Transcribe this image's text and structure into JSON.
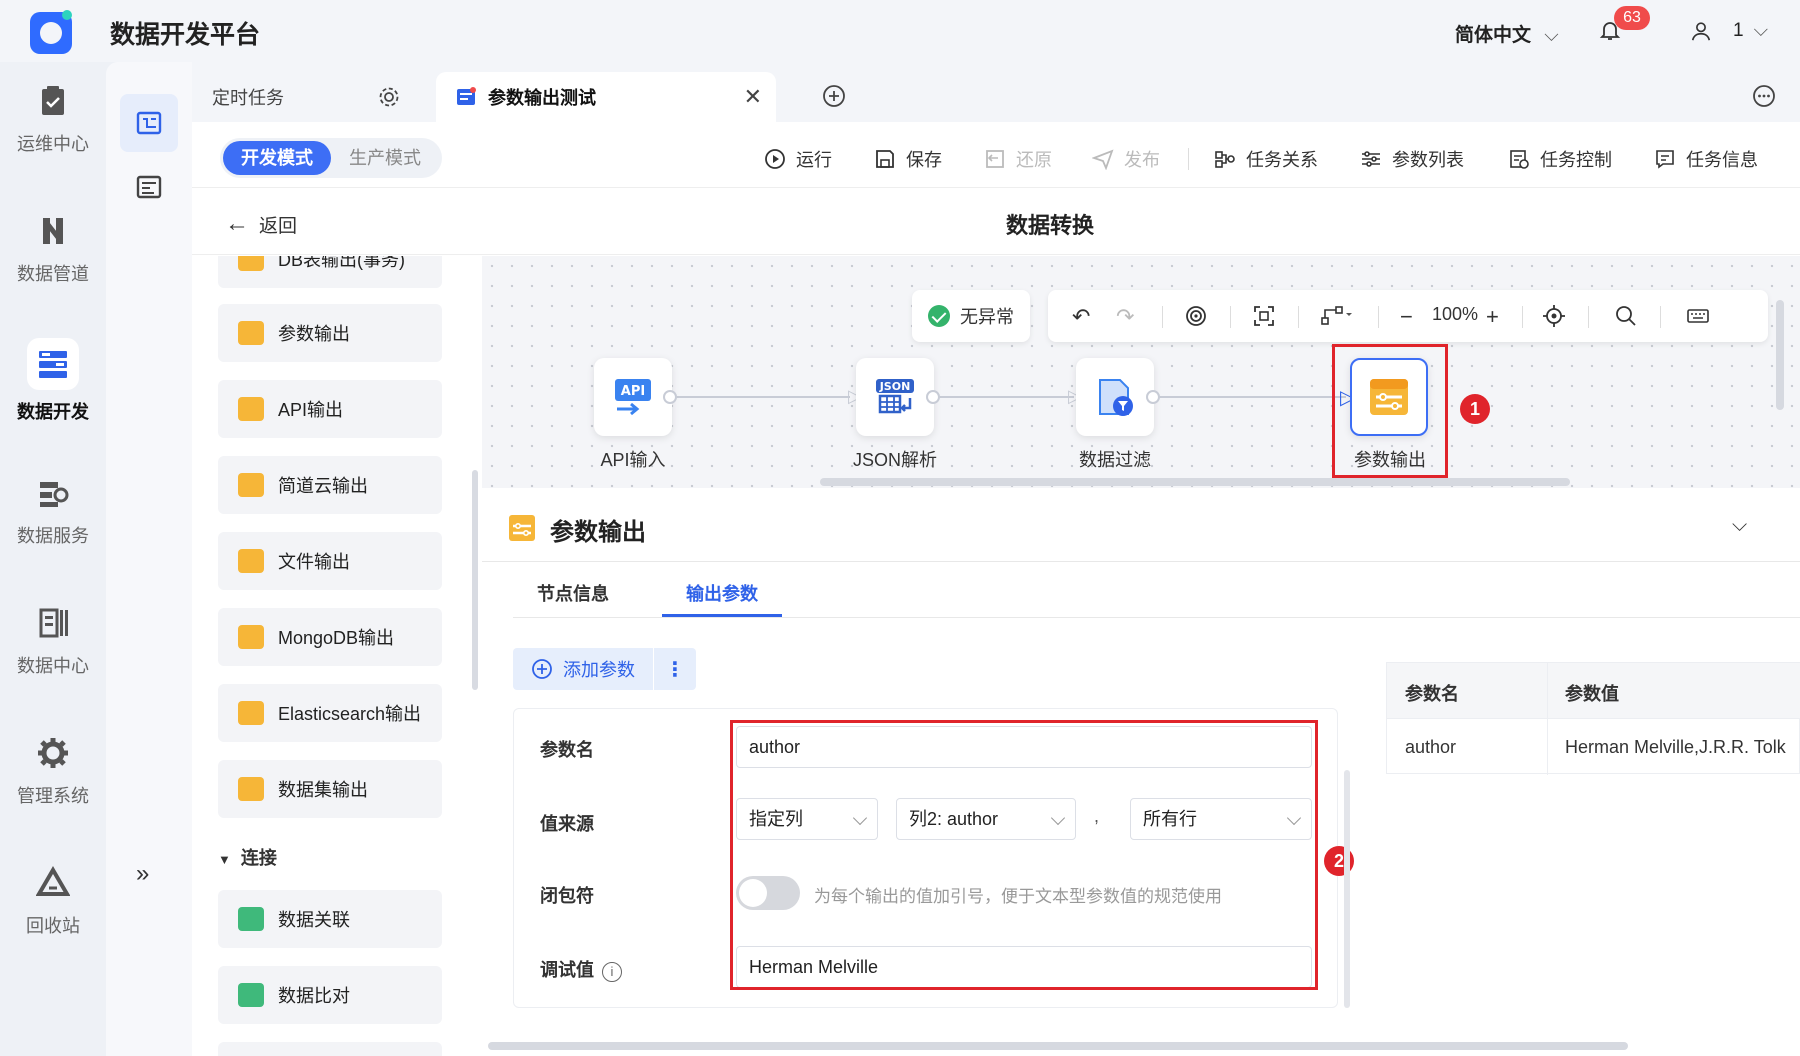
{
  "app": {
    "title": "数据开发平台"
  },
  "header": {
    "language": "简体中文",
    "notification_count": "63",
    "user_name": "1"
  },
  "leftnav": {
    "items": [
      {
        "label": "运维中心",
        "icon": "clipboard-check-icon"
      },
      {
        "label": "数据管道",
        "icon": "pipeline-icon"
      },
      {
        "label": "数据开发",
        "icon": "dev-icon",
        "active": true
      },
      {
        "label": "数据服务",
        "icon": "service-icon"
      },
      {
        "label": "数据中心",
        "icon": "data-center-icon"
      },
      {
        "label": "管理系统",
        "icon": "gear-icon"
      },
      {
        "label": "回收站",
        "icon": "recycle-icon"
      }
    ],
    "expand": "»"
  },
  "tabs": [
    {
      "label": "定时任务"
    },
    {
      "label": "参数输出测试",
      "active": true
    }
  ],
  "modes": {
    "dev": "开发模式",
    "prod": "生产模式"
  },
  "toolbar": {
    "run": "运行",
    "save": "保存",
    "restore": "还原",
    "publish": "发布",
    "relations": "任务关系",
    "param_list": "参数列表",
    "control": "任务控制",
    "info": "任务信息"
  },
  "subheader": {
    "back": "返回",
    "title": "数据转换"
  },
  "palette": {
    "cut_item": "DB表输出(事务)",
    "items": [
      {
        "label": "参数输出"
      },
      {
        "label": "API输出"
      },
      {
        "label": "简道云输出"
      },
      {
        "label": "文件输出"
      },
      {
        "label": "MongoDB输出"
      },
      {
        "label": "Elasticsearch输出"
      },
      {
        "label": "数据集输出"
      }
    ],
    "section": "连接",
    "section_items": [
      {
        "label": "数据关联"
      },
      {
        "label": "数据比对"
      }
    ]
  },
  "canvas": {
    "status": "无异常",
    "zoom": "100%",
    "nodes": [
      {
        "label": "API输入",
        "icon": "api-icon",
        "icon_text": "API"
      },
      {
        "label": "JSON解析",
        "icon": "json-icon",
        "icon_text": "JSON"
      },
      {
        "label": "数据过滤",
        "icon": "filter-icon"
      },
      {
        "label": "参数输出",
        "icon": "param-output-icon",
        "selected": true
      }
    ],
    "markers": [
      "1",
      "2"
    ]
  },
  "panel": {
    "title": "参数输出",
    "tabs": [
      "节点信息",
      "输出参数"
    ],
    "active_tab": "输出参数",
    "add_param": "添加参数",
    "more": "⋮",
    "form": {
      "name_label": "参数名",
      "name_value": "author",
      "source_label": "值来源",
      "source_type": "指定列",
      "source_column": "列2: author",
      "separator": ",",
      "source_rows": "所有行",
      "closure_label": "闭包符",
      "closure_enabled": false,
      "closure_hint": "为每个输出的值加引号，便于文本型参数值的规范使用",
      "debug_label": "调试值",
      "debug_value": "Herman Melville"
    },
    "table": {
      "headers": [
        "参数名",
        "参数值"
      ],
      "rows": [
        [
          "author",
          "Herman Melville,J.R.R. Tolk"
        ]
      ]
    }
  },
  "colors": {
    "accent": "#2f62e8",
    "highlight": "#e0242b",
    "node_orange": "#f6b638"
  }
}
